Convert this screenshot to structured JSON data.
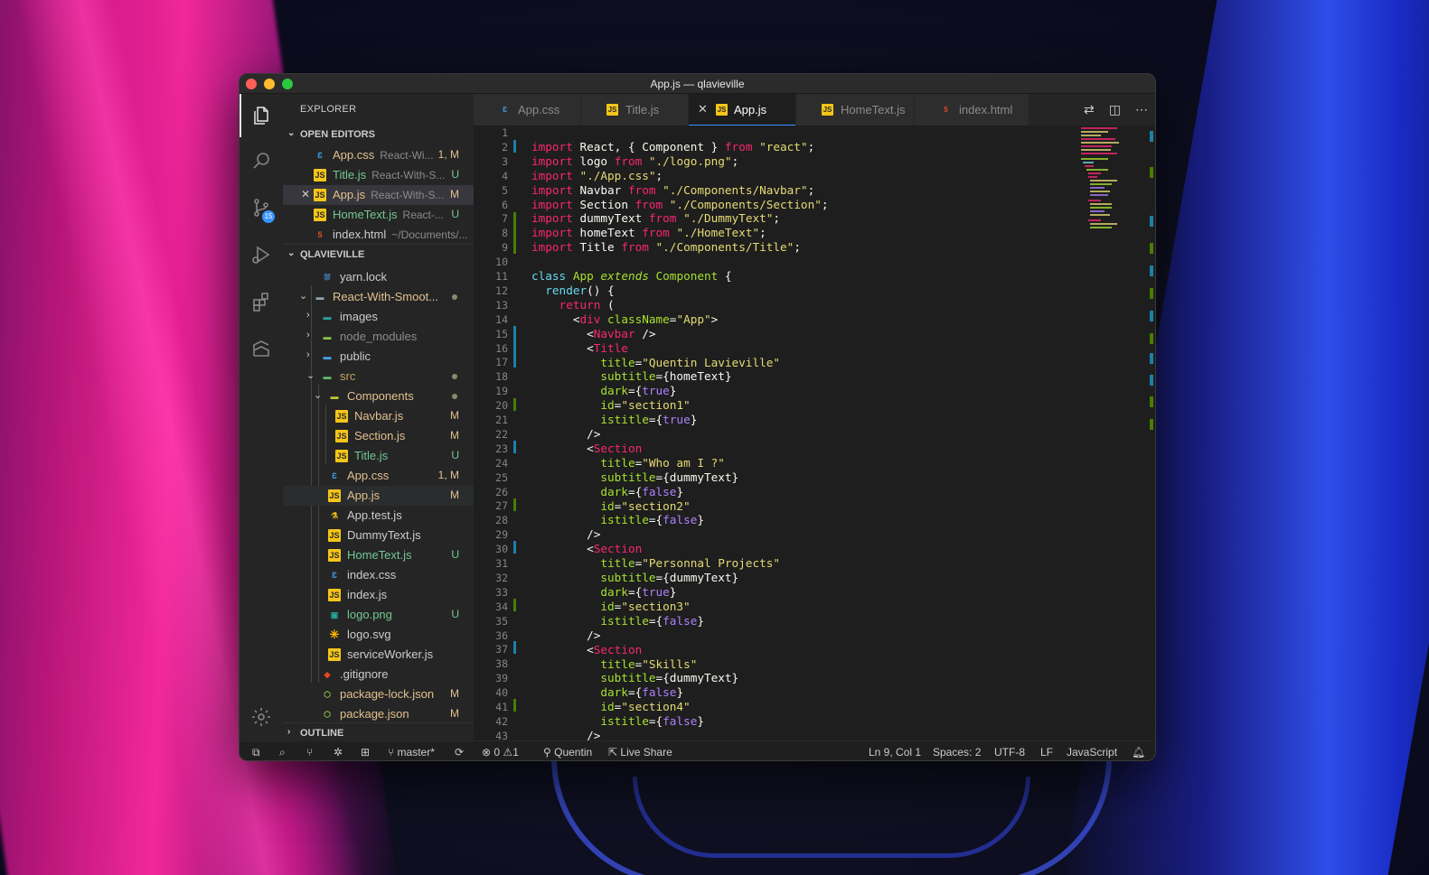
{
  "window": {
    "title": "App.js — qlavieville"
  },
  "explorer": {
    "title": "EXPLORER",
    "open_editors_label": "OPEN EDITORS",
    "project_label": "QLAVIEVILLE",
    "outline_label": "OUTLINE",
    "open_editors": [
      {
        "name": "App.css",
        "desc": "React-Wi...",
        "status": "1, M"
      },
      {
        "name": "Title.js",
        "desc": "React-With-S...",
        "status": "U"
      },
      {
        "name": "App.js",
        "desc": "React-With-S...",
        "status": "M"
      },
      {
        "name": "HomeText.js",
        "desc": "React-...",
        "status": "U"
      },
      {
        "name": "index.html",
        "desc": "~/Documents/...",
        "status": ""
      }
    ],
    "tree": [
      {
        "name": "yarn.lock",
        "status": ""
      },
      {
        "name": "React-With-Smoot...",
        "status": ""
      },
      {
        "name": "images",
        "status": ""
      },
      {
        "name": "node_modules",
        "status": ""
      },
      {
        "name": "public",
        "status": ""
      },
      {
        "name": "src",
        "status": ""
      },
      {
        "name": "Components",
        "status": ""
      },
      {
        "name": "Navbar.js",
        "status": "M"
      },
      {
        "name": "Section.js",
        "status": "M"
      },
      {
        "name": "Title.js",
        "status": "U"
      },
      {
        "name": "App.css",
        "status": "1, M"
      },
      {
        "name": "App.js",
        "status": "M"
      },
      {
        "name": "App.test.js",
        "status": ""
      },
      {
        "name": "DummyText.js",
        "status": ""
      },
      {
        "name": "HomeText.js",
        "status": "U"
      },
      {
        "name": "index.css",
        "status": ""
      },
      {
        "name": "index.js",
        "status": ""
      },
      {
        "name": "logo.png",
        "status": "U"
      },
      {
        "name": "logo.svg",
        "status": ""
      },
      {
        "name": "serviceWorker.js",
        "status": ""
      },
      {
        "name": ".gitignore",
        "status": ""
      },
      {
        "name": "package-lock.json",
        "status": "M"
      },
      {
        "name": "package.json",
        "status": "M"
      }
    ]
  },
  "tabs": [
    {
      "label": "App.css",
      "icon": "css-file-icon"
    },
    {
      "label": "Title.js",
      "icon": "js-file-icon"
    },
    {
      "label": "App.js",
      "icon": "js-file-icon",
      "active": true
    },
    {
      "label": "HomeText.js",
      "icon": "js-file-icon"
    },
    {
      "label": "index.html",
      "icon": "html-file-icon"
    }
  ],
  "editor": {
    "line_numbers": [
      "1",
      "2",
      "3",
      "4",
      "5",
      "6",
      "7",
      "8",
      "9",
      "10",
      "11",
      "12",
      "13",
      "14",
      "15",
      "16",
      "17",
      "18",
      "19",
      "20",
      "21",
      "22",
      "23",
      "24",
      "25",
      "26",
      "27",
      "28",
      "29",
      "30",
      "31",
      "32",
      "33",
      "34",
      "35",
      "36",
      "37",
      "38",
      "39",
      "40",
      "41",
      "42",
      "43"
    ]
  },
  "statusbar": {
    "branch": "master*",
    "errors": "0",
    "warnings": "1",
    "user": "Quentin",
    "live_share": "Live Share",
    "position": "Ln 9, Col 1",
    "spaces": "Spaces: 2",
    "encoding": "UTF-8",
    "eol": "LF",
    "language": "JavaScript"
  },
  "colors": {
    "accent": "#3794ff",
    "modified": "#e2c08d",
    "untracked": "#73c991"
  }
}
